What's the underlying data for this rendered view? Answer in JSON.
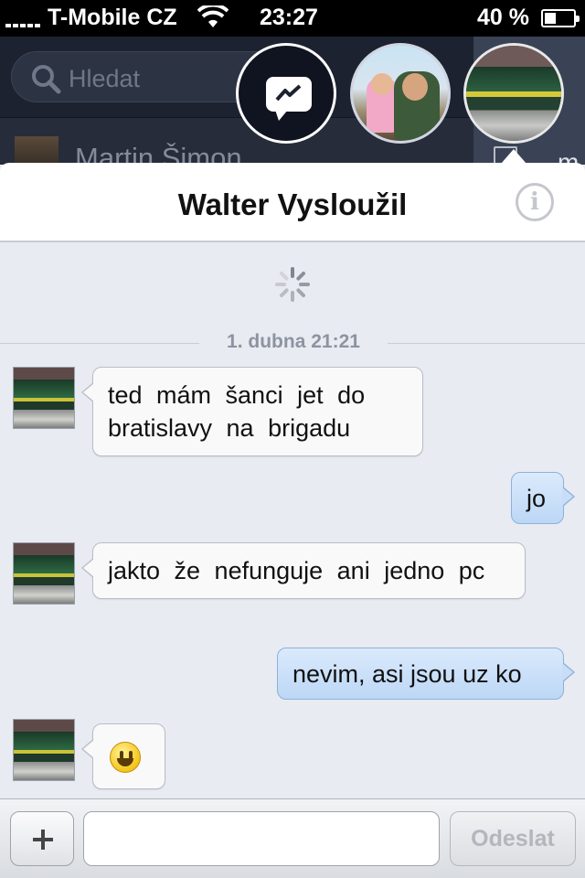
{
  "status_bar": {
    "carrier": "T-Mobile CZ",
    "time": "23:27",
    "battery_percent": "40 %",
    "battery_level": 0.4
  },
  "background": {
    "search_placeholder": "Hledat",
    "contact_name": "Martin Šimon",
    "peek_text": "m"
  },
  "chat": {
    "title": "Walter Vysloužil",
    "info_label": "i",
    "date_separator": "1. dubna 21:21",
    "messages": [
      {
        "direction": "in",
        "text": "ted mám šanci jet do bratislavy na brigadu"
      },
      {
        "direction": "out",
        "text": "jo"
      },
      {
        "direction": "in",
        "text": "jakto že nefunguje ani jedno pc"
      },
      {
        "direction": "out",
        "text": "nevim, asi jsou uz ko"
      },
      {
        "direction": "in",
        "text": "",
        "emoji": "smiley-icon"
      }
    ]
  },
  "composer": {
    "input_value": "",
    "input_placeholder": "",
    "send_label": "Odeslat"
  },
  "colors": {
    "outgoing_bubble": "#c8def8",
    "incoming_bubble": "#f9f9fa",
    "background": "#e8ebf1"
  }
}
